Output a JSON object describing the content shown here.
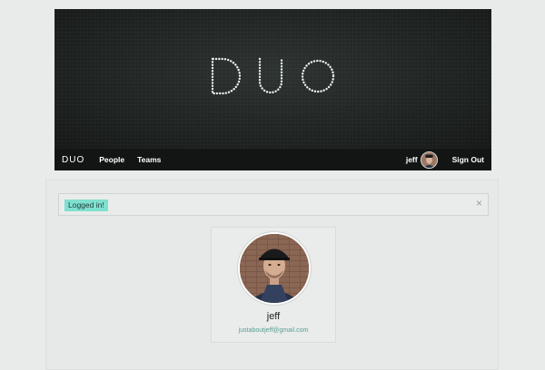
{
  "hero": {
    "logo_text": "DUO"
  },
  "nav": {
    "brand": "DUO",
    "links": [
      {
        "label": "People"
      },
      {
        "label": "Teams"
      }
    ],
    "user_name": "jeff",
    "sign_out_label": "Sign Out"
  },
  "flash": {
    "message": "Logged in!",
    "close_symbol": "×"
  },
  "profile": {
    "name": "jeff",
    "email": "justaboutjeff@gmail.com"
  },
  "colors": {
    "accent": "#7fe0d0",
    "link": "#5a9d94",
    "nav_bg": "#131515"
  }
}
